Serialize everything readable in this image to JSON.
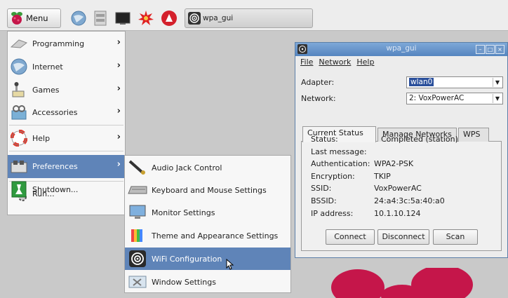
{
  "taskbar": {
    "menu_label": "Menu",
    "launchers": [
      "globe-icon",
      "file-manager-icon",
      "terminal-icon",
      "starburst-icon",
      "game-icon"
    ],
    "task_label": "wpa_gui"
  },
  "main_menu": {
    "items": [
      {
        "label": "Programming",
        "icon": "programming-icon",
        "submenu": true
      },
      {
        "label": "Internet",
        "icon": "internet-icon",
        "submenu": true
      },
      {
        "label": "Games",
        "icon": "games-icon",
        "submenu": true
      },
      {
        "label": "Accessories",
        "icon": "accessories-icon",
        "submenu": true
      },
      {
        "label": "Help",
        "icon": "help-icon",
        "submenu": true
      },
      {
        "label": "Preferences",
        "icon": "preferences-icon",
        "submenu": true,
        "selected": true
      },
      {
        "label": "Run...",
        "icon": "run-icon",
        "submenu": false
      },
      {
        "label": "Shutdown...",
        "icon": "shutdown-icon",
        "submenu": false
      }
    ]
  },
  "sub_menu": {
    "items": [
      {
        "label": "Audio Jack Control",
        "icon": "audio-icon"
      },
      {
        "label": "Keyboard and Mouse Settings",
        "icon": "keyboard-icon"
      },
      {
        "label": "Monitor Settings",
        "icon": "monitor-icon"
      },
      {
        "label": "Theme and Appearance Settings",
        "icon": "theme-icon"
      },
      {
        "label": "WiFi Configuration",
        "icon": "wifi-icon",
        "selected": true
      },
      {
        "label": "Window Settings",
        "icon": "window-icon"
      }
    ]
  },
  "wpa_window": {
    "title": "wpa_gui",
    "menu": {
      "file": "File",
      "network": "Network",
      "help": "Help"
    },
    "adapter_label": "Adapter:",
    "adapter_value": "wlan0",
    "network_label": "Network:",
    "network_value": "2: VoxPowerAC",
    "tabs": [
      "Current Status",
      "Manage Networks",
      "WPS"
    ],
    "status": {
      "status_label": "Status:",
      "status_value": "Completed (station)",
      "last_message_label": "Last message:",
      "last_message_value": "",
      "auth_label": "Authentication:",
      "auth_value": "WPA2-PSK",
      "enc_label": "Encryption:",
      "enc_value": "TKIP",
      "ssid_label": "SSID:",
      "ssid_value": "VoxPowerAC",
      "bssid_label": "BSSID:",
      "bssid_value": "24:a4:3c:5a:40:a0",
      "ip_label": "IP address:",
      "ip_value": "10.1.10.124"
    },
    "buttons": {
      "connect": "Connect",
      "disconnect": "Disconnect",
      "scan": "Scan"
    }
  },
  "colors": {
    "selection": "#5f84b8",
    "titlebar": "#5585bf",
    "raspberry": "#c5164a"
  }
}
